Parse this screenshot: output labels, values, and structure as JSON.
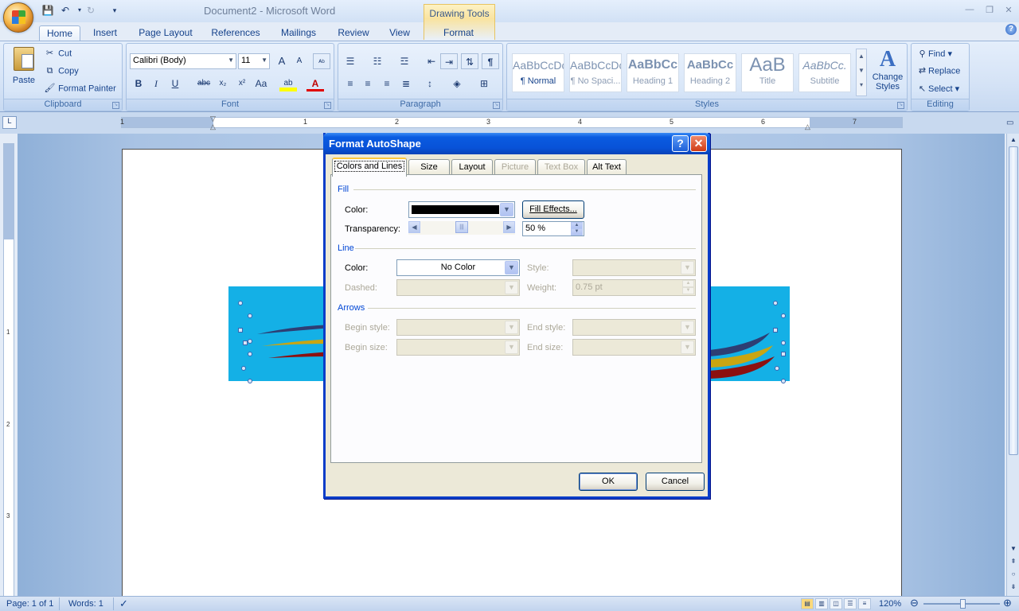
{
  "app": {
    "document_title": "Document2 - Microsoft Word",
    "context_tab_group": "Drawing Tools",
    "help_glyph": "?"
  },
  "tabs": [
    "Home",
    "Insert",
    "Page Layout",
    "References",
    "Mailings",
    "Review",
    "View",
    "Format"
  ],
  "ribbon": {
    "clipboard": {
      "label": "Clipboard",
      "paste": "Paste",
      "cut": "Cut",
      "copy": "Copy",
      "format_painter": "Format Painter"
    },
    "font": {
      "label": "Font",
      "font_name": "Calibri (Body)",
      "font_size": "11",
      "bold": "B",
      "italic": "I",
      "underline": "U",
      "strike": "abc",
      "subscript": "x₂",
      "superscript": "x²",
      "change_case": "Aa",
      "grow": "A",
      "shrink": "A",
      "font_color": "A"
    },
    "paragraph": {
      "label": "Paragraph",
      "pilcrow": "¶"
    },
    "styles": {
      "label": "Styles",
      "change_styles": "Change Styles",
      "items": [
        {
          "preview": "AaBbCcDc",
          "name": "¶ Normal"
        },
        {
          "preview": "AaBbCcDc",
          "name": "¶ No Spaci..."
        },
        {
          "preview": "AaBbCc",
          "name": "Heading 1"
        },
        {
          "preview": "AaBbCc",
          "name": "Heading 2"
        },
        {
          "preview": "AaB",
          "name": "Title"
        },
        {
          "preview": "AaBbCc.",
          "name": "Subtitle"
        }
      ]
    },
    "editing": {
      "label": "Editing",
      "find": "Find",
      "replace": "Replace",
      "select": "Select"
    }
  },
  "ruler": {
    "numbers": [
      "1",
      "1",
      "2",
      "3",
      "4",
      "5",
      "6",
      "7"
    ],
    "vnumbers": [
      "1",
      "2",
      "3"
    ]
  },
  "status": {
    "page": "Page: 1 of 1",
    "words": "Words: 1",
    "zoom": "120%"
  },
  "dialog": {
    "title": "Format AutoShape",
    "tabs": [
      {
        "label": "Colors and Lines",
        "enabled": true
      },
      {
        "label": "Size",
        "enabled": true
      },
      {
        "label": "Layout",
        "enabled": true
      },
      {
        "label": "Picture",
        "enabled": false
      },
      {
        "label": "Text Box",
        "enabled": false
      },
      {
        "label": "Alt Text",
        "enabled": true
      }
    ],
    "fill": {
      "section": "Fill",
      "color_label": "Color:",
      "color_value": "#000000",
      "fill_effects": "Fill Effects...",
      "transparency_label": "Transparency:",
      "transparency_value": "50 %",
      "transparency_level": 0.5
    },
    "line": {
      "section": "Line",
      "color_label": "Color:",
      "color_value": "No Color",
      "style_label": "Style:",
      "dashed_label": "Dashed:",
      "weight_label": "Weight:",
      "weight_value": "0.75 pt"
    },
    "arrows": {
      "section": "Arrows",
      "begin_style": "Begin style:",
      "end_style": "End style:",
      "begin_size": "Begin size:",
      "end_size": "End size:"
    },
    "ok": "OK",
    "cancel": "Cancel"
  },
  "colors": {
    "banner": "#14b0e6",
    "dialog_title": "#0a5be0",
    "accent": "#15428b"
  }
}
